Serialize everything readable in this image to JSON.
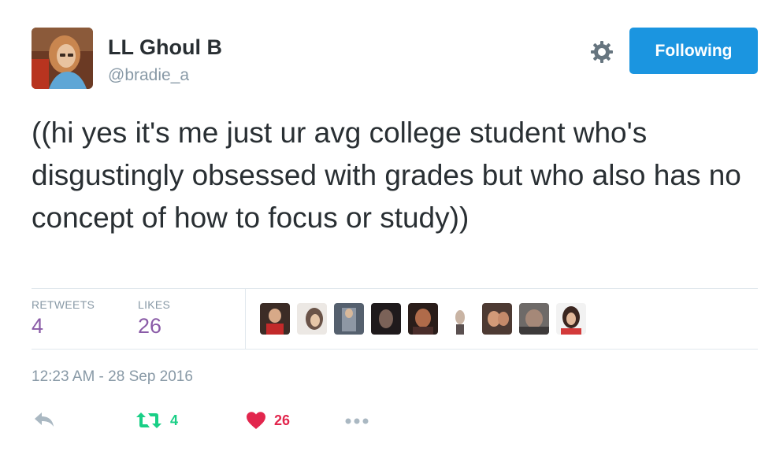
{
  "user": {
    "display_name": "LL Ghoul B",
    "handle": "@bradie_a",
    "avatar": "profile-photo"
  },
  "header": {
    "follow_label": "Following",
    "settings_icon": "gear-icon"
  },
  "tweet": {
    "text": "((hi yes it's me just ur avg college student who's disgustingly obsessed with grades but who also has no concept of how to focus or study))",
    "timestamp": "12:23 AM - 28 Sep 2016"
  },
  "stats": {
    "retweets_label": "RETWEETS",
    "retweets_value": "4",
    "likes_label": "LIKES",
    "likes_value": "26",
    "liker_avatars": 9
  },
  "actions": {
    "reply_icon": "reply-icon",
    "retweet_icon": "retweet-icon",
    "retweet_count": "4",
    "like_icon": "heart-icon",
    "like_count": "26",
    "more_icon": "more-icon"
  },
  "colors": {
    "follow_button": "#1b95e0",
    "stat_value": "#8a5ba7",
    "retweet": "#19cf86",
    "like": "#e2264d",
    "muted": "#8899a6"
  }
}
